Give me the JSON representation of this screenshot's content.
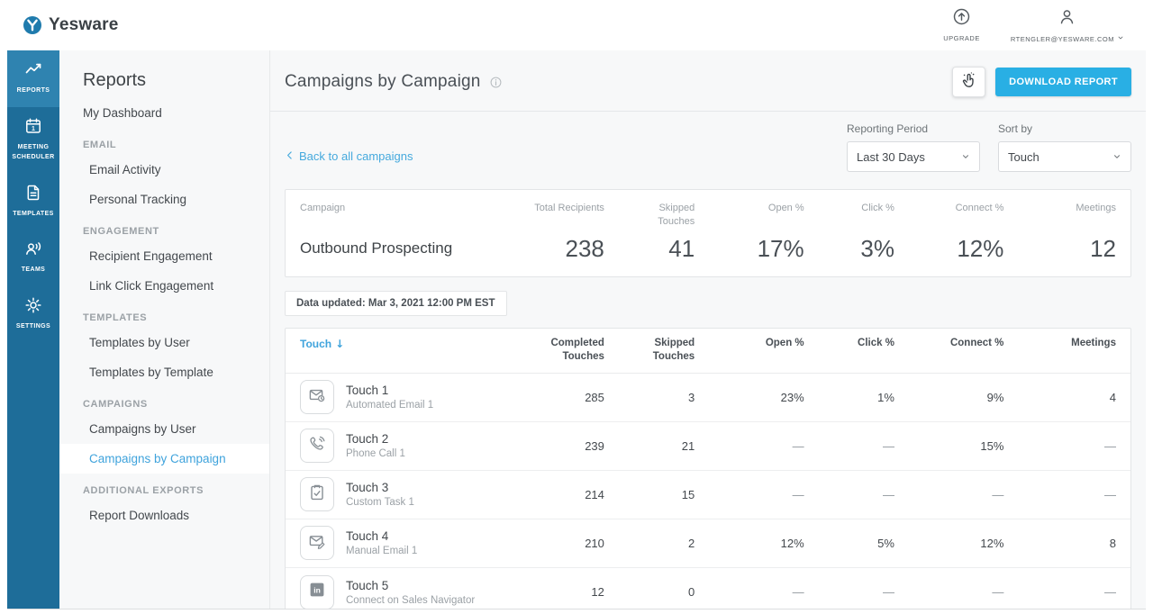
{
  "colors": {
    "sidebar_blue": "#1E6D99",
    "sidebar_active_blue": "#2F83B0",
    "accent_blue": "#3FA3DC",
    "button_blue": "#29AFE4"
  },
  "header": {
    "brand": "Yesware",
    "upgrade_label": "UPGRADE",
    "account_label": "RTENGLER@YESWARE.COM"
  },
  "sidebar": {
    "items": [
      {
        "label": "REPORTS",
        "icon": "reports-icon",
        "active": true
      },
      {
        "label": "MEETING SCHEDULER",
        "icon": "meeting-scheduler-icon",
        "active": false
      },
      {
        "label": "TEMPLATES",
        "icon": "templates-icon",
        "active": false
      },
      {
        "label": "TEAMS",
        "icon": "teams-icon",
        "active": false
      },
      {
        "label": "SETTINGS",
        "icon": "settings-icon",
        "active": false
      }
    ]
  },
  "nav": {
    "title": "Reports",
    "items": [
      {
        "label": "My Dashboard",
        "type": "link",
        "root": true,
        "active": false
      },
      {
        "label": "EMAIL",
        "type": "section"
      },
      {
        "label": "Email Activity",
        "type": "link",
        "active": false
      },
      {
        "label": "Personal Tracking",
        "type": "link",
        "active": false
      },
      {
        "label": "ENGAGEMENT",
        "type": "section"
      },
      {
        "label": "Recipient Engagement",
        "type": "link",
        "active": false
      },
      {
        "label": "Link Click Engagement",
        "type": "link",
        "active": false
      },
      {
        "label": "TEMPLATES",
        "type": "section"
      },
      {
        "label": "Templates by User",
        "type": "link",
        "active": false
      },
      {
        "label": "Templates by Template",
        "type": "link",
        "active": false
      },
      {
        "label": "CAMPAIGNS",
        "type": "section"
      },
      {
        "label": "Campaigns by User",
        "type": "link",
        "active": false
      },
      {
        "label": "Campaigns by Campaign",
        "type": "link",
        "active": true
      },
      {
        "label": "ADDITIONAL EXPORTS",
        "type": "section"
      },
      {
        "label": "Report Downloads",
        "type": "link",
        "active": false
      }
    ]
  },
  "main": {
    "title": "Campaigns by Campaign",
    "download_label": "DOWNLOAD REPORT",
    "back_link": "Back to all campaigns",
    "filters": {
      "reporting_period": {
        "label": "Reporting Period",
        "value": "Last 30 Days"
      },
      "sort_by": {
        "label": "Sort by",
        "value": "Touch"
      }
    },
    "summary": {
      "columns": [
        "Campaign",
        "Total Recipients",
        "Skipped Touches",
        "Open %",
        "Click %",
        "Connect %",
        "Meetings"
      ],
      "campaign_name": "Outbound Prospecting",
      "values": [
        "238",
        "41",
        "17%",
        "3%",
        "12%",
        "12"
      ]
    },
    "data_updated": "Data updated: Mar 3, 2021 12:00 PM EST",
    "table": {
      "columns": [
        "Touch",
        "Completed Touches",
        "Skipped Touches",
        "Open %",
        "Click %",
        "Connect %",
        "Meetings"
      ],
      "sort_column": "Touch",
      "sort_indicator": "↓",
      "rows": [
        {
          "title": "Touch 1",
          "subtitle": "Automated Email 1",
          "icon": "automated-email-icon",
          "values": [
            "285",
            "3",
            "23%",
            "1%",
            "9%",
            "4"
          ]
        },
        {
          "title": "Touch 2",
          "subtitle": "Phone Call 1",
          "icon": "phone-call-icon",
          "values": [
            "239",
            "21",
            "—",
            "—",
            "15%",
            "—"
          ]
        },
        {
          "title": "Touch 3",
          "subtitle": "Custom Task 1",
          "icon": "custom-task-icon",
          "values": [
            "214",
            "15",
            "—",
            "—",
            "—",
            "—"
          ]
        },
        {
          "title": "Touch 4",
          "subtitle": "Manual Email 1",
          "icon": "manual-email-icon",
          "values": [
            "210",
            "2",
            "12%",
            "5%",
            "12%",
            "8"
          ]
        },
        {
          "title": "Touch 5",
          "subtitle": "Connect on Sales Navigator",
          "icon": "linkedin-icon",
          "values": [
            "12",
            "0",
            "—",
            "—",
            "—",
            "—"
          ]
        }
      ]
    }
  }
}
